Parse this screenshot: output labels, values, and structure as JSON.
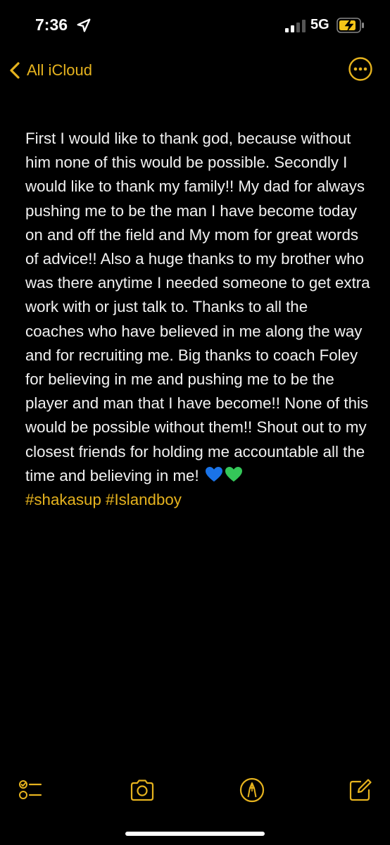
{
  "status_bar": {
    "time": "7:36",
    "network": "5G"
  },
  "nav": {
    "back_label": "All iCloud",
    "more_icon": "ellipsis-circle-icon"
  },
  "note": {
    "text": "First I would like to thank god, because without him none of this would be possible. Secondly I would like to thank my family!! My dad for always pushing me to be the man I have become today on and off the field and My mom for great words of advice!! Also a huge thanks to my brother who was there anytime I needed someone to get extra work with or just talk to. Thanks to all the coaches who have believed in me along the way and for recruiting me. Big thanks to coach Foley for believing in me and pushing me to be the player and man that I have become!! None of this would be possible without them!! Shout out to my closest friends for holding me accountable all the time and believing in me!",
    "emojis": [
      "blue-heart",
      "green-heart"
    ],
    "hashtags": "#shakasup #Islandboy"
  },
  "toolbar": {
    "icons": [
      "checklist-icon",
      "camera-icon",
      "markup-pen-icon",
      "compose-icon"
    ]
  },
  "colors": {
    "accent": "#e6b31e",
    "background": "#000000",
    "text": "#f2f2f2",
    "blue_heart": "#1a73e8",
    "green_heart": "#34c759"
  }
}
